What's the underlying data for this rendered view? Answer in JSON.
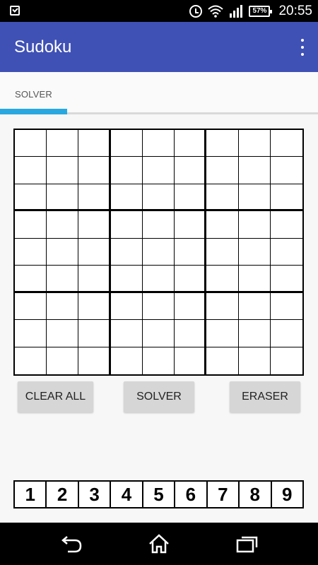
{
  "status_bar": {
    "time": "20:55",
    "battery": "57%"
  },
  "app_bar": {
    "title": "Sudoku"
  },
  "tabs": [
    {
      "label": "SOLVER",
      "active": true
    }
  ],
  "grid": {
    "rows": 9,
    "cols": 9,
    "values": []
  },
  "buttons": {
    "clear_all": "CLEAR ALL",
    "solver": "SOLVER",
    "eraser": "ERASER"
  },
  "numpad": [
    "1",
    "2",
    "3",
    "4",
    "5",
    "6",
    "7",
    "8",
    "9"
  ],
  "colors": {
    "app_bar": "#3f51b5",
    "tab_indicator": "#29a8e0",
    "button": "#d6d6d6"
  }
}
